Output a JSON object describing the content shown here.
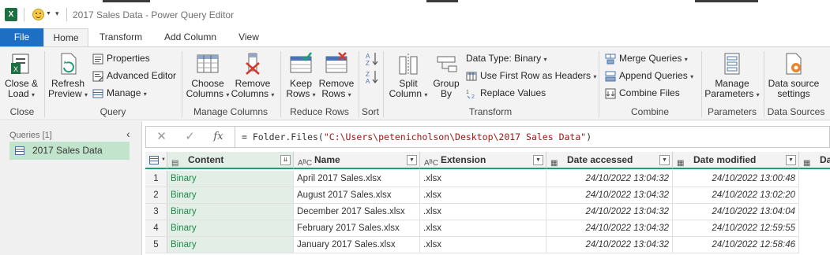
{
  "title_bar": {
    "title": "2017 Sales Data - Power Query Editor"
  },
  "tabs": [
    {
      "label": "File"
    },
    {
      "label": "Home"
    },
    {
      "label": "Transform"
    },
    {
      "label": "Add Column"
    },
    {
      "label": "View"
    }
  ],
  "ribbon": {
    "close": {
      "close_load": [
        "Close &",
        "Load"
      ],
      "group": "Close"
    },
    "query": {
      "refresh_preview": [
        "Refresh",
        "Preview"
      ],
      "properties": "Properties",
      "advanced_editor": "Advanced Editor",
      "manage": "Manage",
      "group": "Query"
    },
    "manage_columns": {
      "choose_columns": [
        "Choose",
        "Columns"
      ],
      "remove_columns": [
        "Remove",
        "Columns"
      ],
      "group": "Manage Columns"
    },
    "reduce_rows": {
      "keep_rows": [
        "Keep",
        "Rows"
      ],
      "remove_rows": [
        "Remove",
        "Rows"
      ],
      "group": "Reduce Rows"
    },
    "sort": {
      "group": "Sort"
    },
    "transform": {
      "split_column": [
        "Split",
        "Column"
      ],
      "group_by": [
        "Group",
        "By"
      ],
      "data_type": "Data Type: Binary",
      "first_row_headers": "Use First Row as Headers",
      "replace_values": "Replace Values",
      "group": "Transform"
    },
    "combine": {
      "merge_queries": "Merge Queries",
      "append_queries": "Append Queries",
      "combine_files": "Combine Files",
      "group": "Combine"
    },
    "parameters": {
      "manage_parameters": [
        "Manage",
        "Parameters"
      ],
      "group": "Parameters"
    },
    "data_sources": {
      "settings": [
        "Data source",
        "settings"
      ],
      "group": "Data Sources"
    }
  },
  "queries_pane": {
    "header": "Queries [1]",
    "items": [
      "2017 Sales Data"
    ]
  },
  "formula_bar": {
    "prefix": "= Folder.Files(",
    "string": "\"C:\\Users\\petenicholson\\Desktop\\2017 Sales Data\"",
    "suffix": ")"
  },
  "grid": {
    "columns": [
      {
        "label": "Content",
        "type_icon": "binary"
      },
      {
        "label": "Name",
        "type_icon": "ABC"
      },
      {
        "label": "Extension",
        "type_icon": "ABC"
      },
      {
        "label": "Date accessed",
        "type_icon": "datetime"
      },
      {
        "label": "Date modified",
        "type_icon": "datetime"
      },
      {
        "label": "Da",
        "type_icon": "datetime"
      }
    ],
    "rows": [
      {
        "n": "1",
        "content": "Binary",
        "name": "April 2017 Sales.xlsx",
        "ext": ".xlsx",
        "accessed": "24/10/2022 13:04:32",
        "modified": "24/10/2022 13:00:48"
      },
      {
        "n": "2",
        "content": "Binary",
        "name": "August 2017 Sales.xlsx",
        "ext": ".xlsx",
        "accessed": "24/10/2022 13:04:32",
        "modified": "24/10/2022 13:02:20"
      },
      {
        "n": "3",
        "content": "Binary",
        "name": "December 2017 Sales.xlsx",
        "ext": ".xlsx",
        "accessed": "24/10/2022 13:04:32",
        "modified": "24/10/2022 13:04:04"
      },
      {
        "n": "4",
        "content": "Binary",
        "name": "February 2017 Sales.xlsx",
        "ext": ".xlsx",
        "accessed": "24/10/2022 13:04:32",
        "modified": "24/10/2022 12:59:55"
      },
      {
        "n": "5",
        "content": "Binary",
        "name": "January 2017 Sales.xlsx",
        "ext": ".xlsx",
        "accessed": "24/10/2022 13:04:32",
        "modified": "24/10/2022 12:58:46"
      }
    ]
  },
  "colors": {
    "file_tab": "#1e6fc4",
    "selected_column": "#e3efe6",
    "header_underline": "#1e9e74",
    "binary_text": "#1e8a4c"
  }
}
